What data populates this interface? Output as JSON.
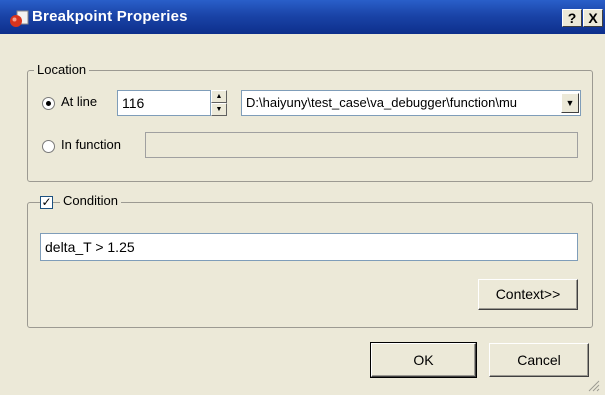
{
  "window": {
    "title": "Breakpoint Properies",
    "help_label": "?",
    "close_label": "X"
  },
  "location": {
    "legend": "Location",
    "at_line": {
      "label": "At line",
      "value": "116",
      "selected": true
    },
    "file_path": "D:\\haiyuny\\test_case\\va_debugger\\function\\mu",
    "in_function": {
      "label": "In function",
      "value": "",
      "selected": false
    }
  },
  "condition": {
    "legend": "Condition",
    "checked": true,
    "expression": "delta_T > 1.25",
    "context_button": "Context>>"
  },
  "buttons": {
    "ok": "OK",
    "cancel": "Cancel"
  },
  "icons": {
    "app": "app-icon",
    "spin_up": "spin-up-icon",
    "spin_down": "spin-down-icon",
    "dropdown": "dropdown-arrow-icon",
    "check": "check-icon",
    "grip": "resize-grip-icon"
  },
  "colors": {
    "titlebar": "#1a44a8",
    "dialog_bg": "#ece9d8"
  }
}
